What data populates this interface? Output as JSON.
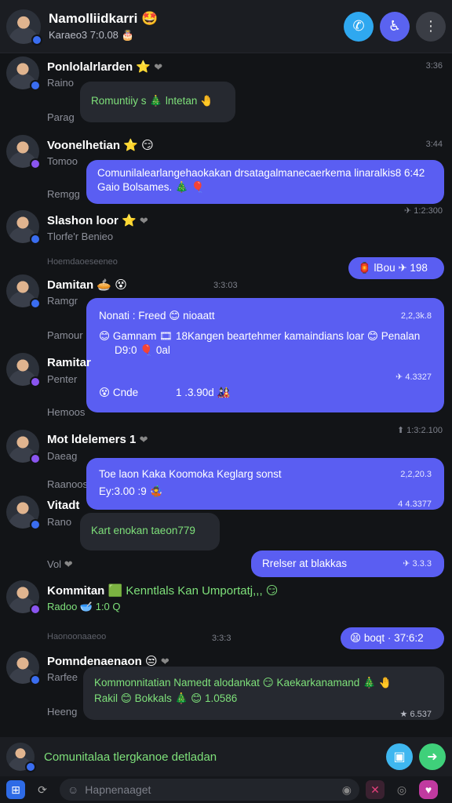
{
  "header": {
    "title": "Namolliidkarri",
    "subtitle": "Karaeo3 7:0.08 🎂",
    "title_emoji": "🤩"
  },
  "messages": [
    {
      "sender": "Ponlolalrlarden",
      "emoji": "⭐",
      "sub1": "Raino",
      "sub2": "Parag",
      "bubble": "Romuntiiy s 🎄 lntetan 🤚",
      "time": "3:36"
    },
    {
      "sender": "Voonelhetian",
      "emoji": "⭐ 😏",
      "sub1": "Tomoo",
      "sub2": "Remgg",
      "bubble": "Comunilalearlangehaokakan drsatagalmanecaerkema linaralkis8 6:42 Gaio Bolsames. 🎄 🎈",
      "time": "3:44",
      "btime": "✈ 1:2:300"
    },
    {
      "sender": "Slashon loor",
      "emoji": "⭐",
      "sub1": "Tlorfe'r Benieo",
      "sub2": "Hoemdaoeseeneo",
      "bubble": "🏮 lBou ✈ 198"
    },
    {
      "sender": "Damitan",
      "emoji": "🥧 😵",
      "sub1": "Ramgr",
      "sub2": "Pamour",
      "time": "3:3:03",
      "bubble_line1": "Nonati : Freed 😊 nioaatt",
      "bubble_line1_time": "2,2,3k.8",
      "bubble_line2": "😊 Gamnam 🎞 18Kangen beartehmer kamaindians loar 😊 Penalan",
      "bubble_line3": "D9:0 🎈 0al",
      "bubble_mid_time": "✈ 4.3327",
      "bubble_line4": "😵 Cnde",
      "bubble_line4_b": "1 .3.90d 🎎"
    },
    {
      "sender": "Ramitar",
      "sub1": "Penter",
      "sub2": "Hemoos",
      "time": "⬆ 1:3:2.100"
    },
    {
      "sender": "Mot ldelemers",
      "emoji": "1",
      "sub1": "Daeag",
      "sub2": "Raanoos",
      "bubble_line1": "Toe laon Kaka Koomoka Keglarg sonst",
      "bubble_line1_time": "2,2,20.3",
      "bubble_line2": "Ey:3.00 :9 🤹",
      "bubble_mid_time": "4 4.3377"
    },
    {
      "sender": "Vitadt",
      "sub1": "Rano",
      "bubble": "Kart enokan taeon779"
    },
    {
      "sub1": "Vol",
      "bubble": "Rrelser at blakkas",
      "bubble_time": "✈ 3.3.3"
    },
    {
      "sender": "Kommitan",
      "sender_tail": "🟩 Kenntlals Kan Umportatj,,, 😏",
      "sub1": "Radoo 🥣 1:0 Q",
      "sub2": "Haonoonaaeoo",
      "time": "3:3:3",
      "bubble": "😫 boqt · 37:6:2"
    },
    {
      "sender": "Pomndenaenaon",
      "emoji": "😒",
      "sub1": "Rarfee",
      "sub2": "Heeng",
      "bubble_line1": "Kommonnitatian Namedt alodankat 😏 Kaekarkanamand 🎄 🤚",
      "bubble_line2": "Rakil 😊 Bokkals 🎄 😊 1.0586",
      "bubble_time": "★ 6.537"
    }
  ],
  "composer": {
    "text": "Comunitalaa tlergkanoe detladan"
  },
  "bottom": {
    "placeholder": "Hapnenaaget"
  },
  "colors": {
    "accent": "#5a5ef2",
    "call": "#2fa8f0",
    "video": "#5a63f0",
    "send": "#3fd07a",
    "doc": "#3fb7f0"
  }
}
